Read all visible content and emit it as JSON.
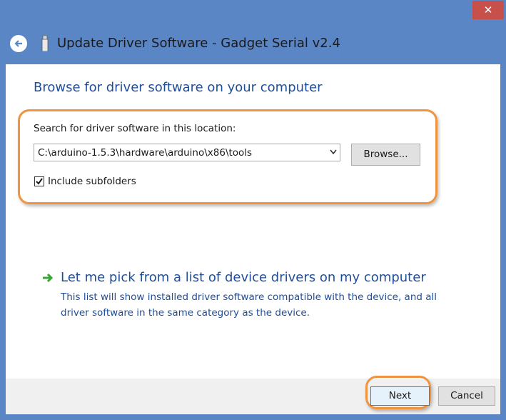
{
  "window": {
    "title": "Update Driver Software - Gadget Serial v2.4",
    "close_glyph": "✕"
  },
  "main": {
    "heading": "Browse for driver software on your computer",
    "location_label": "Search for driver software in this location:",
    "path_value": "C:\\arduino-1.5.3\\hardware\\arduino\\x86\\tools",
    "browse_label": "Browse...",
    "include_subfolders_label": "Include subfolders",
    "include_subfolders_checked": true
  },
  "pick": {
    "link_text": "Let me pick from a list of device drivers on my computer",
    "description": "This list will show installed driver software compatible with the device, and all driver software in the same category as the device."
  },
  "footer": {
    "next_label": "Next",
    "cancel_label": "Cancel"
  },
  "colors": {
    "titlebar": "#5b86c5",
    "heading": "#1f4e99",
    "highlight": "#f0943f",
    "close": "#c7514a",
    "arrow": "#3aa63a"
  }
}
